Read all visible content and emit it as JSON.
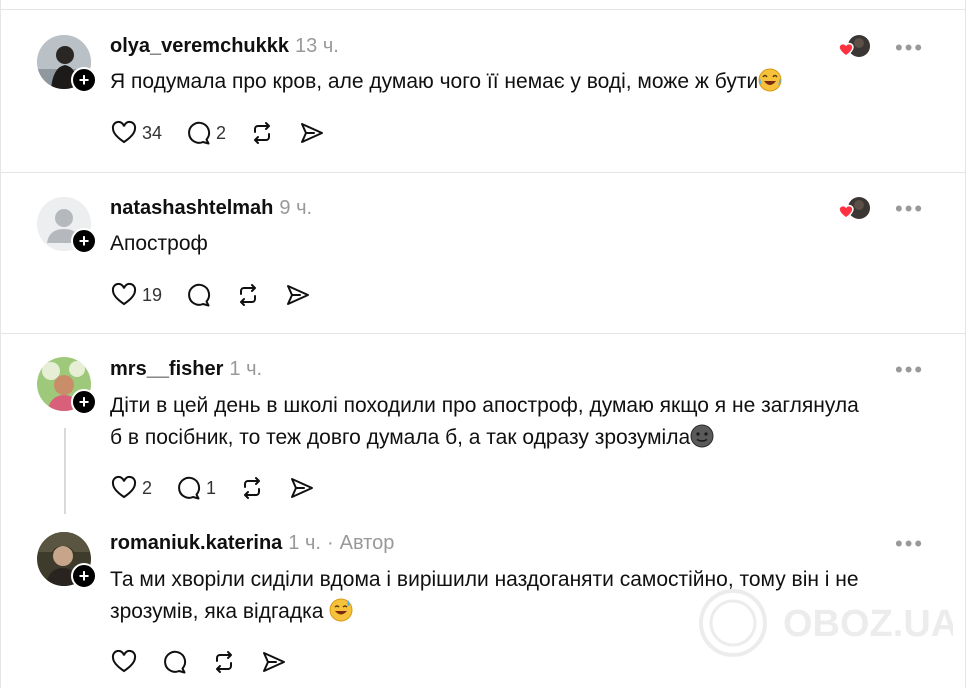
{
  "posts": [
    {
      "username": "olya_veremchukkk",
      "time": "13 ч.",
      "text": "Я подумала про кров, але думаю чого її немає у воді, може ж бути",
      "emoji": "joy-emoji",
      "likes": "34",
      "replies": "2",
      "liked_by_author": true
    },
    {
      "username": "natashashtelmah",
      "time": "9 ч.",
      "text": "Апостроф",
      "likes": "19",
      "replies": "",
      "liked_by_author": true
    },
    {
      "username": "mrs__fisher",
      "time": "1 ч.",
      "text_line1": "Діти в цей день в школі походили про апостроф, думаю якщо я не заглянула",
      "text_line2": "б в посібник, то теж довго думала б, а так одразу зрозуміла",
      "emoji": "neutral-face-emoji",
      "likes": "2",
      "replies": "1"
    },
    {
      "username": "romaniuk.katerina",
      "time": "1 ч.",
      "author_sep": "·",
      "author_label": "Автор",
      "text_line1": "Та ми хворіли сиділи вдома і вирішили наздоганяти самостійно, тому він і не",
      "text_line2": "зрозумів, яка відгадка",
      "emoji": "sweat-smile-emoji",
      "likes": "",
      "replies": ""
    }
  ],
  "more_label": "•••",
  "follow_label": "+",
  "watermark": "OBOZ.UA",
  "colors": {
    "text": "#101010",
    "muted": "#999999",
    "divider": "#e5e5e5",
    "like_heart": "#ff3040"
  }
}
